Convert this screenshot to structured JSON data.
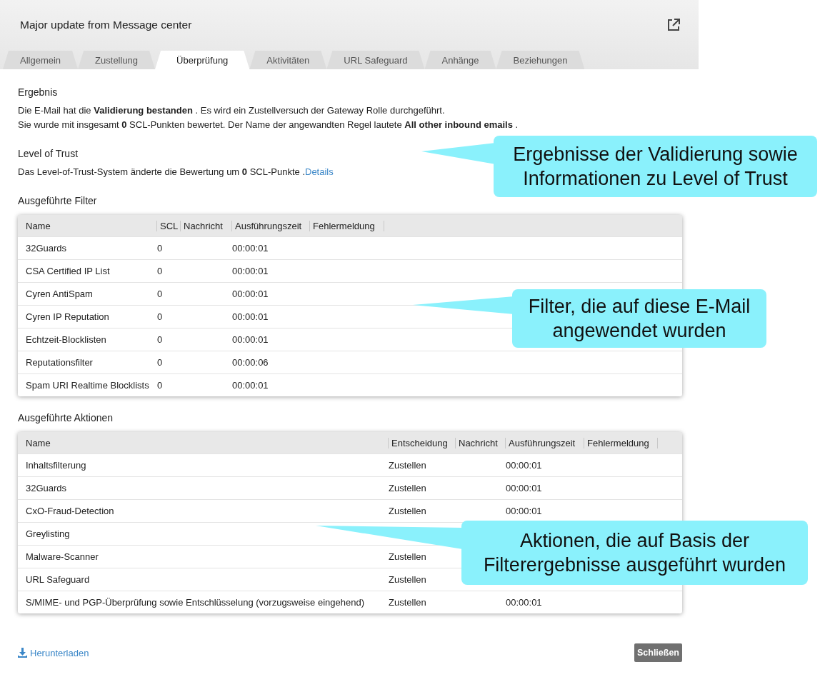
{
  "window": {
    "title": "Major update from Message center"
  },
  "tabs": [
    {
      "label": "Allgemein",
      "selected": false
    },
    {
      "label": "Zustellung",
      "selected": false
    },
    {
      "label": "Überprüfung",
      "selected": true
    },
    {
      "label": "Aktivitäten",
      "selected": false
    },
    {
      "label": "URL Safeguard",
      "selected": false
    },
    {
      "label": "Anhänge",
      "selected": false
    },
    {
      "label": "Beziehungen",
      "selected": false
    }
  ],
  "result": {
    "heading": "Ergebnis",
    "lines": [
      "Die E-Mail hat die **Validierung bestanden** . Es wird ein Zustellversuch der Gateway Rolle durchgeführt.",
      "Sie wurde mit insgesamt **0** SCL-Punkten bewertet. Der Name der angewandten Regel lautete **All other inbound emails** ."
    ]
  },
  "trust": {
    "heading": "Level of Trust",
    "text": "Das Level-of-Trust-System änderte die Bewertung um **0** SCL-Punkte .",
    "link": "Details"
  },
  "filters": {
    "heading": "Ausgeführte Filter",
    "columns": [
      "Name",
      "SCL",
      "Nachricht",
      "Ausführungszeit",
      "Fehlermeldung"
    ],
    "rows": [
      [
        "32Guards",
        "0",
        "",
        "00:00:01",
        ""
      ],
      [
        "CSA Certified IP List",
        "0",
        "",
        "00:00:01",
        ""
      ],
      [
        "Cyren AntiSpam",
        "0",
        "",
        "00:00:01",
        ""
      ],
      [
        "Cyren IP Reputation",
        "0",
        "",
        "00:00:01",
        ""
      ],
      [
        "Echtzeit-Blocklisten",
        "0",
        "",
        "00:00:01",
        ""
      ],
      [
        "Reputationsfilter",
        "0",
        "",
        "00:00:06",
        ""
      ],
      [
        "Spam URI Realtime Blocklists",
        "0",
        "",
        "00:00:01",
        ""
      ]
    ]
  },
  "actions": {
    "heading": "Ausgeführte Aktionen",
    "columns": [
      "Name",
      "Entscheidung",
      "Nachricht",
      "Ausführungszeit",
      "Fehlermeldung"
    ],
    "rows": [
      [
        "Inhaltsfilterung",
        "Zustellen",
        "",
        "00:00:01",
        ""
      ],
      [
        "32Guards",
        "Zustellen",
        "",
        "00:00:01",
        ""
      ],
      [
        "CxO-Fraud-Detection",
        "Zustellen",
        "",
        "00:00:01",
        ""
      ],
      [
        "Greylisting",
        "",
        "",
        "",
        ""
      ],
      [
        "Malware-Scanner",
        "Zustellen",
        "",
        "",
        ""
      ],
      [
        "URL Safeguard",
        "Zustellen",
        "",
        "",
        ""
      ],
      [
        "S/MIME- und PGP-Überprüfung sowie Entschlüsselung (vorzugsweise eingehend)",
        "Zustellen",
        "",
        "00:00:01",
        ""
      ]
    ]
  },
  "download": "Herunterladen",
  "close": "Schließen",
  "callouts": [
    {
      "lines": [
        "Ergebnisse der Validierung sowie",
        "Informationen zu Level of Trust"
      ]
    },
    {
      "lines": [
        "Filter, die auf diese E-Mail",
        "angewendet wurden"
      ]
    },
    {
      "lines": [
        "Aktionen, die auf Basis der",
        "Filterergebnisse ausgeführt wurden"
      ]
    }
  ]
}
